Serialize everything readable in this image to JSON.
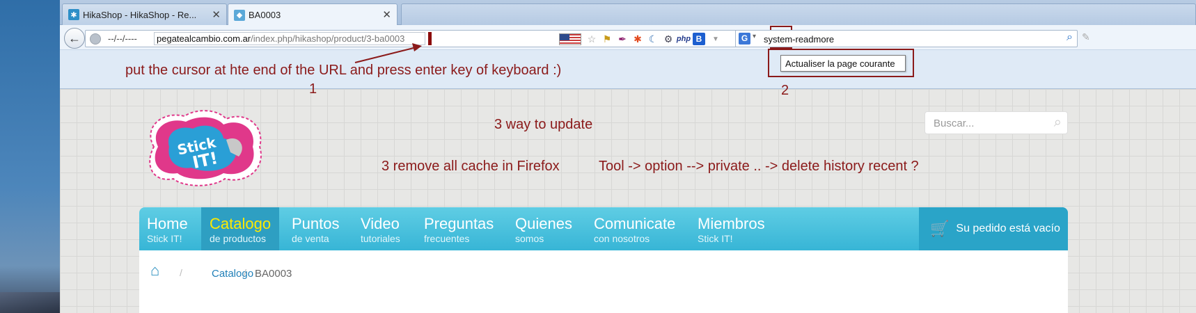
{
  "tabs": [
    {
      "title": "HikaShop - HikaShop - Re...",
      "close": "✕"
    },
    {
      "title": "BA0003",
      "close": "✕"
    }
  ],
  "navbar": {
    "back_icon": "back-arrow-icon",
    "date": "--/--/----",
    "url_host": "pegatealcambio.com.ar",
    "url_path": "/index.php/hikashop/product/3-ba0003",
    "search_engine": "G",
    "search_value": "system-readmore"
  },
  "tooltip": "Actualiser la page courante",
  "annotations": {
    "step1_text": "put the cursor at hte end of the URL and press enter key of keyboard  :)",
    "step1_num": "1",
    "step2_num": "2",
    "ways": "3 way to update",
    "step3_a": "3 remove all cache in Firefox",
    "step3_b": "Tool -> option --> private .. -> delete history recent ?"
  },
  "page": {
    "search_placeholder": "Buscar...",
    "menu": [
      {
        "title": "Home",
        "sub": "Stick IT!"
      },
      {
        "title": "Catalogo",
        "sub": "de productos"
      },
      {
        "title": "Puntos",
        "sub": "de venta"
      },
      {
        "title": "Video",
        "sub": "tutoriales"
      },
      {
        "title": "Preguntas",
        "sub": "frecuentes"
      },
      {
        "title": "Quienes",
        "sub": "somos"
      },
      {
        "title": "Comunicate",
        "sub": "con nosotros"
      },
      {
        "title": "Miembros",
        "sub": "Stick IT!"
      }
    ],
    "cart": "Su pedido está vacío",
    "breadcrumb": {
      "link": "Catalogo",
      "current": "BA0003"
    },
    "logo_text": "Stick IT!"
  },
  "colors": {
    "annotation": "#8b1a1a",
    "menu_bg": "#37b5d6",
    "menu_active_text": "#ffea00"
  }
}
